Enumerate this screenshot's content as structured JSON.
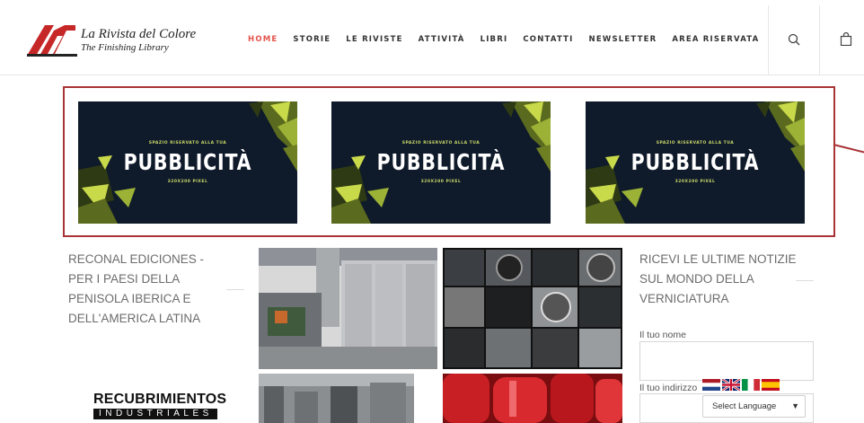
{
  "header": {
    "site_title": "La Rivista del Colore",
    "site_subtitle": "The Finishing Library",
    "nav": [
      "HOME",
      "STORIE",
      "LE RIVISTE",
      "ATTIVITÀ",
      "LIBRI",
      "CONTATTI",
      "NEWSLETTER",
      "AREA RISERVATA"
    ],
    "active_nav": "HOME",
    "icons": [
      "search-icon",
      "shopping-bag-icon"
    ]
  },
  "ads": [
    {
      "small": "SPAZIO RISERVATO ALLA TUA",
      "big": "PUBBLICITÀ",
      "size": "320X200 PIXEL"
    },
    {
      "small": "SPAZIO RISERVATO ALLA TUA",
      "big": "PUBBLICITÀ",
      "size": "320X200 PIXEL"
    },
    {
      "small": "SPAZIO RISERVATO ALLA TUA",
      "big": "PUBBLICITÀ",
      "size": "320X200 PIXEL"
    }
  ],
  "left": {
    "title": "RECONAL EDICIONES - PER I PAESI DELLA PENISOLA IBERICA E DELL'AMERICA LATINA",
    "logo_line1": "RECUBRIMIENTOS",
    "logo_line2": "INDUSTRIALES"
  },
  "right": {
    "title": "RICEVI LE ULTIME NOTIZIE SUL MONDO DELLA VERNICIATURA",
    "name_label": "Il tuo nome",
    "email_label": "Il tuo indirizzo",
    "language_select": "Select Language"
  },
  "colors": {
    "accent": "#e4524a",
    "frame": "#a83236",
    "ad_bg": "#0f1a2a",
    "ad_green": "#c9d96a"
  }
}
